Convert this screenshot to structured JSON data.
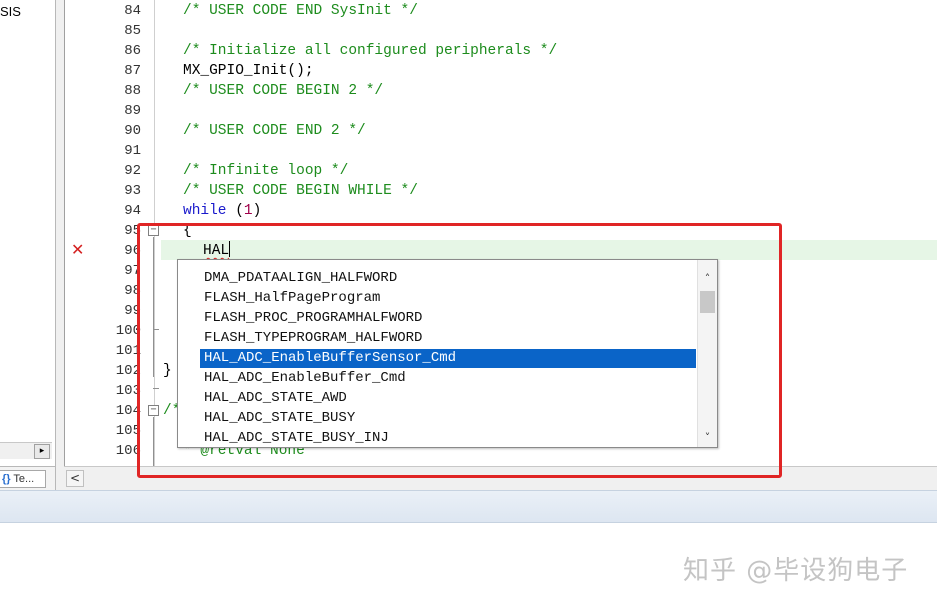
{
  "project_panel": {
    "tree_partial_label": "SIS",
    "tab_label": "Te...",
    "tab_icon_glyph": "{}",
    "hscroll_right_arrow": "▸"
  },
  "editor": {
    "lines": [
      {
        "num": "84",
        "code": "/* USER CODE END SysInit */",
        "kind": "comment"
      },
      {
        "num": "85",
        "code": "",
        "kind": "plain"
      },
      {
        "num": "86",
        "code": "/* Initialize all configured peripherals */",
        "kind": "comment"
      },
      {
        "num": "87",
        "code": "MX_GPIO_Init();",
        "kind": "plain"
      },
      {
        "num": "88",
        "code": "/* USER CODE BEGIN 2 */",
        "kind": "comment"
      },
      {
        "num": "89",
        "code": "",
        "kind": "plain"
      },
      {
        "num": "90",
        "code": "/* USER CODE END 2 */",
        "kind": "comment"
      },
      {
        "num": "91",
        "code": "",
        "kind": "plain"
      },
      {
        "num": "92",
        "code": "/* Infinite loop */",
        "kind": "comment"
      },
      {
        "num": "93",
        "code": "/* USER CODE BEGIN WHILE */",
        "kind": "comment"
      },
      {
        "num": "94",
        "keyword": "while",
        "paren_open": " (",
        "number": "1",
        "paren_close": ")",
        "kind": "while"
      },
      {
        "num": "95",
        "code": "{",
        "kind": "plain"
      },
      {
        "num": "96",
        "code": "HAL",
        "kind": "typed"
      },
      {
        "num": "97",
        "code": "",
        "kind": "plain"
      },
      {
        "num": "98",
        "code": "",
        "kind": "plain"
      },
      {
        "num": "99",
        "code": "",
        "kind": "plain"
      },
      {
        "num": "100",
        "code": "",
        "kind": "plain"
      },
      {
        "num": "101",
        "code": "",
        "kind": "plain"
      },
      {
        "num": "102",
        "code": "}",
        "kind": "plain"
      },
      {
        "num": "103",
        "code": "",
        "kind": "plain"
      },
      {
        "num": "104",
        "code": "/*",
        "kind": "comment"
      },
      {
        "num": "105",
        "code": "",
        "kind": "plain"
      },
      {
        "num": "106",
        "code": "* @retval None",
        "kind": "comment"
      }
    ],
    "error_glyph": "✕",
    "hscroll_left_arrow": "<"
  },
  "autocomplete": {
    "items": [
      "DMA_PDATAALIGN_HALFWORD",
      "FLASH_HalfPageProgram",
      "FLASH_PROC_PROGRAMHALFWORD",
      "FLASH_TYPEPROGRAM_HALFWORD",
      "HAL_ADC_EnableBufferSensor_Cmd",
      "HAL_ADC_EnableBuffer_Cmd",
      "HAL_ADC_STATE_AWD",
      "HAL_ADC_STATE_BUSY",
      "HAL_ADC_STATE_BUSY_INJ"
    ],
    "selected_index": 4,
    "scroll_up_glyph": "˄",
    "scroll_down_glyph": "˅"
  },
  "watermark": {
    "text": "知乎 @毕设狗电子"
  },
  "colors": {
    "comment": "#1d8c1d",
    "keyword": "#1a1acc",
    "selection": "#0a64c8",
    "highlight_frame": "#e02525",
    "error": "#d42020",
    "active_line": "#e6f6e6"
  }
}
